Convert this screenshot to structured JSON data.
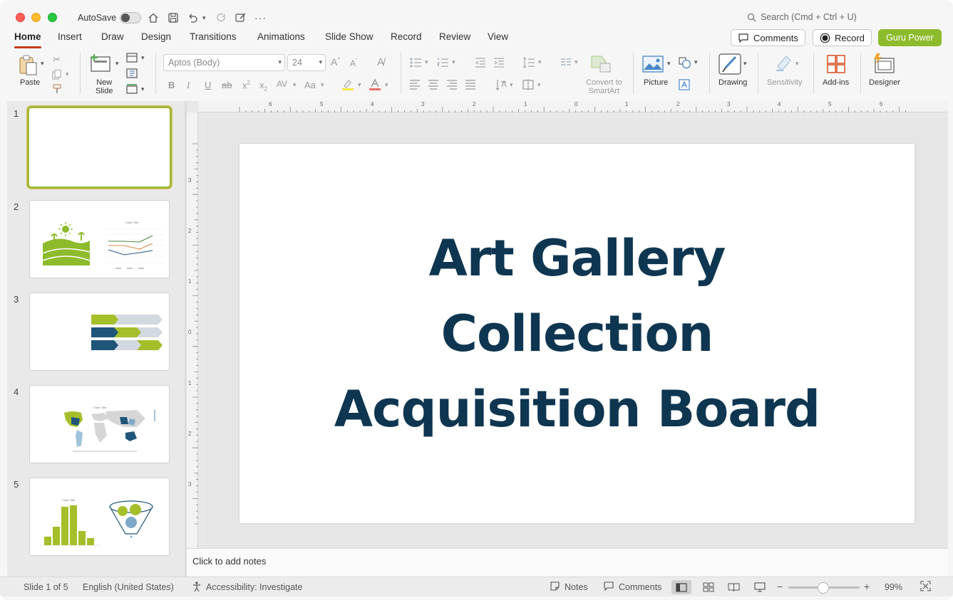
{
  "titlebar": {
    "autosave_label": "AutoSave",
    "search_placeholder": "Search (Cmd + Ctrl + U)"
  },
  "tabs": [
    "Home",
    "Insert",
    "Draw",
    "Design",
    "Transitions",
    "Animations",
    "Slide Show",
    "Record",
    "Review",
    "View"
  ],
  "actions": {
    "comments_label": "Comments",
    "record_label": "Record",
    "guru_label": "Guru Power"
  },
  "ribbon": {
    "paste_label": "Paste",
    "new_slide_label": "New\nSlide",
    "font_name": "Aptos (Body)",
    "font_size": "24",
    "convert_label": "Convert to\nSmartArt",
    "picture_label": "Picture",
    "drawing_label": "Drawing",
    "sensitivity_label": "Sensitivity",
    "addins_label": "Add-ins",
    "designer_label": "Designer"
  },
  "thumbnails": [
    {
      "number": "1"
    },
    {
      "number": "2",
      "chart_title": "Chart Title"
    },
    {
      "number": "3"
    },
    {
      "number": "4",
      "chart_title": "Chart Title"
    },
    {
      "number": "5",
      "chart_title": "Chart Title"
    }
  ],
  "slide": {
    "title_line1": "Art Gallery",
    "title_line2": "Collection",
    "title_line3": "Acquisition Board",
    "title_color": "#0e3651"
  },
  "ruler": {
    "h_labels": [
      "6",
      "5",
      "4",
      "3",
      "2",
      "1",
      "0",
      "1",
      "2",
      "3",
      "4",
      "5",
      "6"
    ],
    "v_labels": [
      "3",
      "2",
      "1",
      "0",
      "1",
      "2",
      "3"
    ]
  },
  "notes": {
    "placeholder": "Click to add notes"
  },
  "status": {
    "slide_info": "Slide 1 of 5",
    "language": "English (United States)",
    "accessibility": "Accessibility: Investigate",
    "notes_label": "Notes",
    "comments_label": "Comments",
    "zoom_minus": "−",
    "zoom_plus": "+",
    "zoom_level": "99%"
  },
  "colors": {
    "accent_tab": "#c43e1c",
    "guru_green": "#8dbb2c",
    "thumb_selected": "#a4b83a"
  }
}
